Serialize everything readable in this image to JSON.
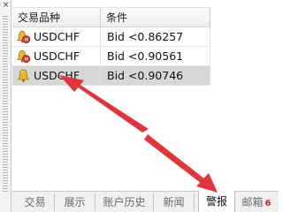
{
  "toolbox": {
    "close_glyph": "×",
    "columns": [
      "交易品种",
      "条件"
    ],
    "rows": [
      {
        "symbol": "USDCHF",
        "condition": "Bid <0.86257",
        "icon": "alert-bell-disabled-icon",
        "selected": false
      },
      {
        "symbol": "USDCHF",
        "condition": "Bid <0.90561",
        "icon": "alert-bell-disabled-icon",
        "selected": false
      },
      {
        "symbol": "USDCHF",
        "condition": "Bid <0.90746",
        "icon": "alert-bell-icon",
        "selected": true
      }
    ],
    "tabs": [
      {
        "label": "交易",
        "active": false
      },
      {
        "label": "展示",
        "active": false
      },
      {
        "label": "账户历史",
        "active": false
      },
      {
        "label": "新闻",
        "active": false
      },
      {
        "label": "警报",
        "active": true
      },
      {
        "label": "邮箱",
        "active": false,
        "badge": "6"
      }
    ]
  },
  "annotation": {
    "arrow_color": "#e0353c"
  },
  "colors": {
    "selected_row": "#d7d7d7",
    "bell_gold": "#e8b732",
    "stop_red": "#d8322c",
    "badge_red": "#d32020"
  }
}
